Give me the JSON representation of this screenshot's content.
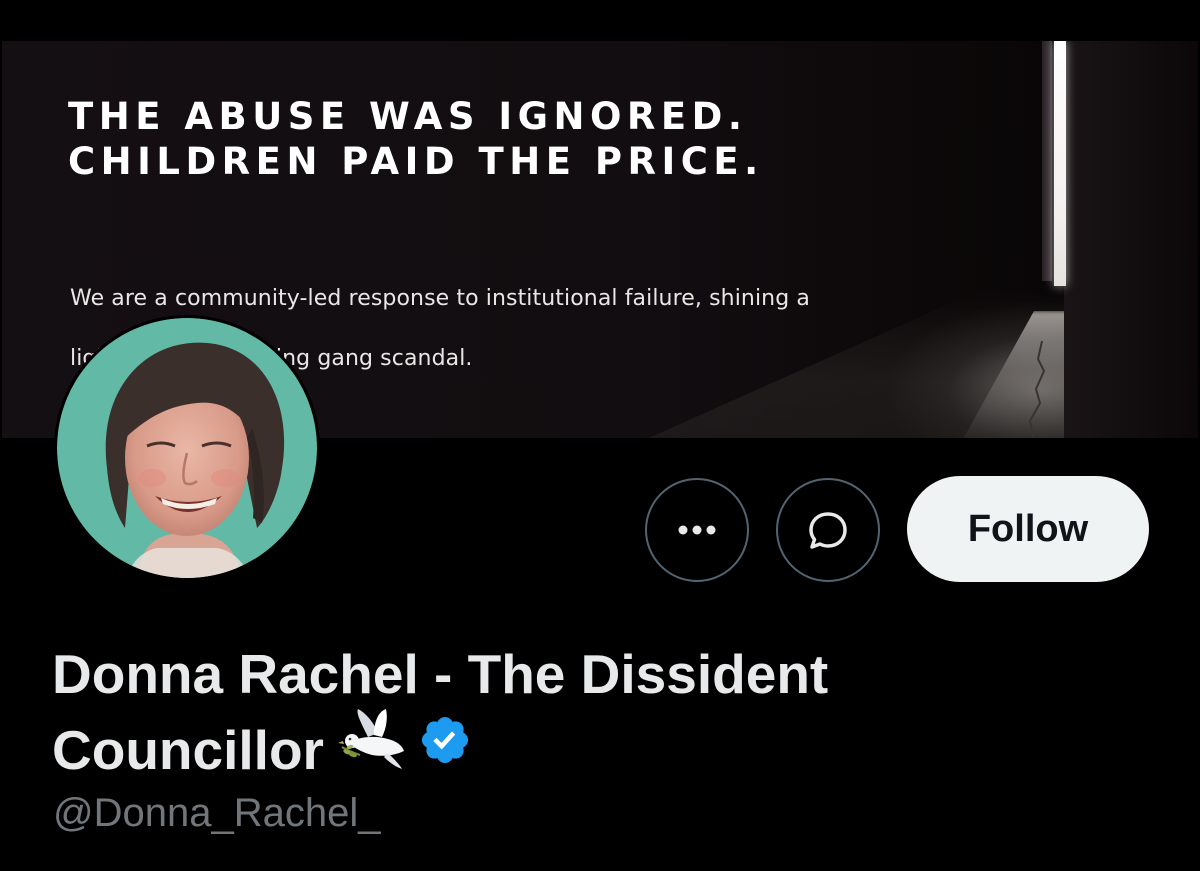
{
  "banner": {
    "headline_line1": "THE ABUSE WAS IGNORED.",
    "headline_line2": "CHILDREN PAID THE PRICE.",
    "subtext_line1": "We are a community-led response to institutional failure, shining a",
    "subtext_line2": "light on the grooming gang scandal."
  },
  "actions": {
    "more_icon": "more-horizontal-icon",
    "message_icon": "message-bubble-icon",
    "follow_label": "Follow"
  },
  "profile": {
    "name_part1": "Donna Rachel - The Dissident",
    "name_part2": "Councillor",
    "name_emoji": "dove-of-peace-icon",
    "verified_icon": "verified-badge-icon",
    "handle": "@Donna_Rachel_"
  },
  "colors": {
    "background": "#000000",
    "follow_bg": "#eff3f4",
    "follow_text": "#0f1419",
    "button_border": "#536471",
    "name_text": "#e7e9ea",
    "handle_text": "#71767b",
    "verified_blue": "#1d9bf0",
    "avatar_backdrop": "#5fb5a3"
  }
}
